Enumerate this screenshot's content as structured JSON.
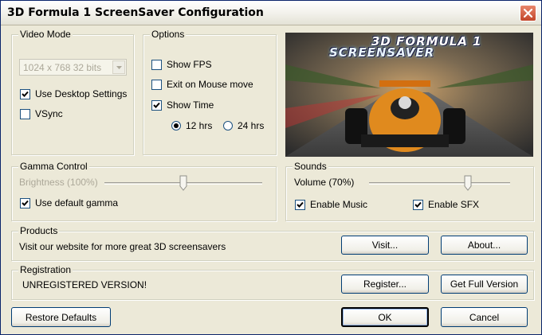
{
  "window": {
    "title": "3D Formula 1 ScreenSaver Configuration",
    "close_icon": "close-icon"
  },
  "video_mode": {
    "legend": "Video Mode",
    "resolution": "1024 x 768 32 bits",
    "use_desktop_settings": {
      "label": "Use Desktop Settings",
      "checked": true
    },
    "vsync": {
      "label": "VSync",
      "checked": false
    }
  },
  "options": {
    "legend": "Options",
    "show_fps": {
      "label": "Show FPS",
      "checked": false
    },
    "exit_on_mouse_move": {
      "label": "Exit on Mouse move",
      "checked": false
    },
    "show_time": {
      "label": "Show Time",
      "checked": true
    },
    "hours_12": {
      "label": "12 hrs",
      "selected": true
    },
    "hours_24": {
      "label": "24 hrs",
      "selected": false
    }
  },
  "preview": {
    "title_line1": "3D FORMULA 1",
    "title_line2": "SCREENSAVER"
  },
  "gamma": {
    "legend": "Gamma Control",
    "brightness_label": "Brightness (100%)",
    "brightness_fraction": 0.5,
    "use_default_gamma": {
      "label": "Use default gamma",
      "checked": true
    }
  },
  "sounds": {
    "legend": "Sounds",
    "volume_label": "Volume (70%)",
    "volume_fraction": 0.7,
    "enable_music": {
      "label": "Enable Music",
      "checked": true
    },
    "enable_sfx": {
      "label": "Enable SFX",
      "checked": true
    }
  },
  "products": {
    "legend": "Products",
    "text": "Visit our website for more great 3D screensavers",
    "visit": "Visit...",
    "about": "About..."
  },
  "registration": {
    "legend": "Registration",
    "status": "UNREGISTERED VERSION!",
    "register": "Register...",
    "full_version": "Get Full Version"
  },
  "footer": {
    "restore": "Restore Defaults",
    "ok": "OK",
    "cancel": "Cancel"
  }
}
